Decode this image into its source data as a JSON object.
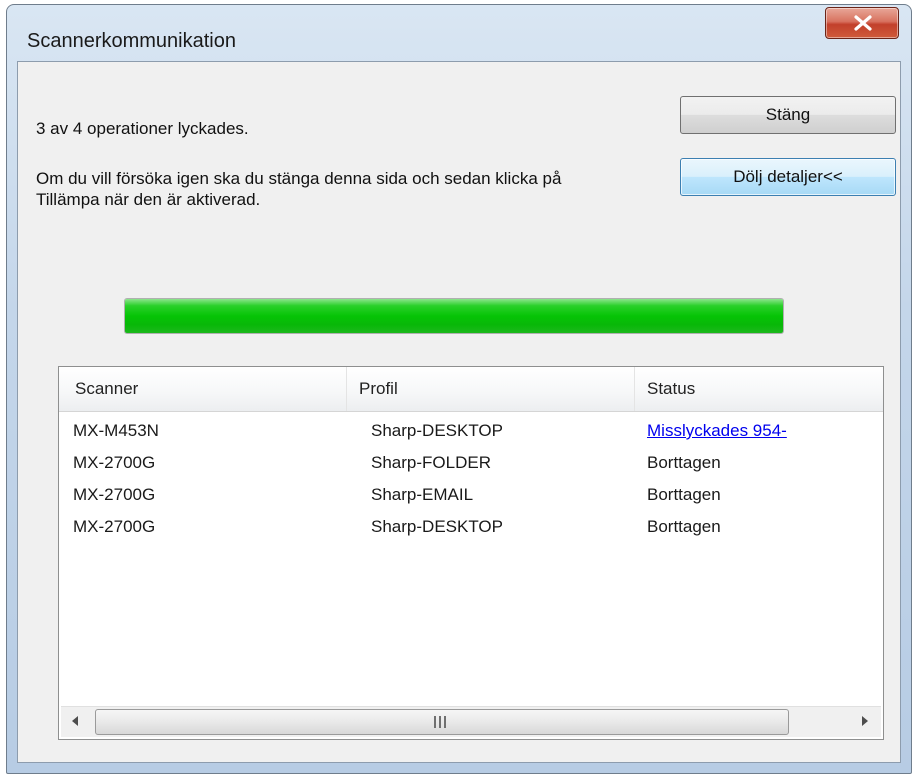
{
  "window": {
    "title": "Scannerkommunikation"
  },
  "message": {
    "summary": "3 av 4 operationer lyckades.",
    "instruction": "Om du vill försöka igen ska du stänga denna sida och sedan klicka på Tillämpa när den är aktiverad."
  },
  "buttons": {
    "close_label": "Stäng",
    "toggle_details_label": "Dölj detaljer<<"
  },
  "progress": {
    "fraction": 1.0,
    "color": "#06c406"
  },
  "table": {
    "columns": [
      "Scanner",
      "Profil",
      "Status"
    ],
    "rows": [
      {
        "scanner": "MX-M453N",
        "profile_prefix": "Sharp",
        "profile_name": "-DESKTOP",
        "status": "Misslyckades 954-",
        "status_is_link": true
      },
      {
        "scanner": "MX-2700G",
        "profile_prefix": "Sharp",
        "profile_name": "-FOLDER",
        "status": "Borttagen",
        "status_is_link": false
      },
      {
        "scanner": "MX-2700G",
        "profile_prefix": "Sharp",
        "profile_name": "-EMAIL",
        "status": "Borttagen",
        "status_is_link": false
      },
      {
        "scanner": "MX-2700G",
        "profile_prefix": "Sharp",
        "profile_name": "-DESKTOP",
        "status": "Borttagen",
        "status_is_link": false
      }
    ]
  },
  "icons": {
    "close": "close-x-icon",
    "scroll_left": "scroll-left-arrow-icon",
    "scroll_right": "scroll-right-arrow-icon",
    "grip": "scroll-grip-icon"
  },
  "colors": {
    "link": "#0000ee",
    "close_button": "#c2402b"
  }
}
